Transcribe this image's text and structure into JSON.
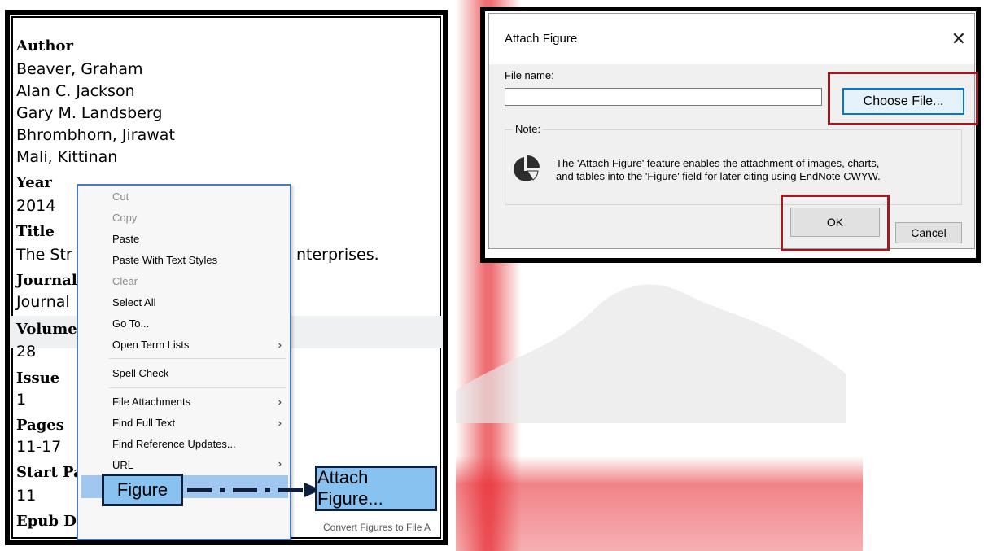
{
  "reference": {
    "author_label": "Author",
    "authors": [
      "Beaver, Graham",
      "Alan C. Jackson",
      "Gary M. Landsberg",
      "Bhrombhorn, Jirawat",
      "Mali, Kittinan"
    ],
    "year_label": "Year",
    "year": "2014",
    "title_label": "Title",
    "title_left": "The Str",
    "title_right": "nterprises.",
    "journal_label": "Journal",
    "journal_value": "Journal",
    "volume_label": "Volume",
    "volume": "28",
    "issue_label": "Issue",
    "issue": "1",
    "pages_label": "Pages",
    "pages": "11-17",
    "start_page_label": "Start Pa",
    "start_page": "11",
    "epub_label": "Epub Date"
  },
  "context_menu": {
    "items": [
      {
        "label": "Cut",
        "enabled": false
      },
      {
        "label": "Copy",
        "enabled": false
      },
      {
        "label": "Paste",
        "enabled": true
      },
      {
        "label": "Paste With Text Styles",
        "enabled": true
      },
      {
        "label": "Clear",
        "enabled": false
      },
      {
        "label": "Select All",
        "enabled": true
      },
      {
        "label": "Go To...",
        "enabled": true
      },
      {
        "label": "Open Term Lists",
        "enabled": true,
        "submenu": true
      },
      {
        "label": "Spell Check",
        "enabled": true
      },
      {
        "label": "File Attachments",
        "enabled": true,
        "submenu": true
      },
      {
        "label": "Find Full Text",
        "enabled": true,
        "submenu": true
      },
      {
        "label": "Find Reference Updates...",
        "enabled": true
      },
      {
        "label": "URL",
        "enabled": true,
        "submenu": true
      }
    ],
    "submenu_arrow": "›",
    "figure_label": "Figure",
    "attach_figure_label": "Attach Figure...",
    "convert_label": "Convert Figures to File A"
  },
  "dialog": {
    "title": "Attach Figure",
    "close_glyph": "✕",
    "file_name_label": "File name:",
    "file_name_value": "",
    "choose_file_label": "Choose File...",
    "note_label": "Note:",
    "note_line1": "The 'Attach Figure' feature enables the attachment of images, charts,",
    "note_line2": "and tables into the 'Figure' field for later citing using EndNote CWYW.",
    "ok_label": "OK",
    "cancel_label": "Cancel"
  },
  "colors": {
    "highlight_blue": "#88c2f0",
    "menu_border": "#4b7bbf",
    "callout_red": "#9b1b22",
    "focus_blue": "#0078d7"
  }
}
